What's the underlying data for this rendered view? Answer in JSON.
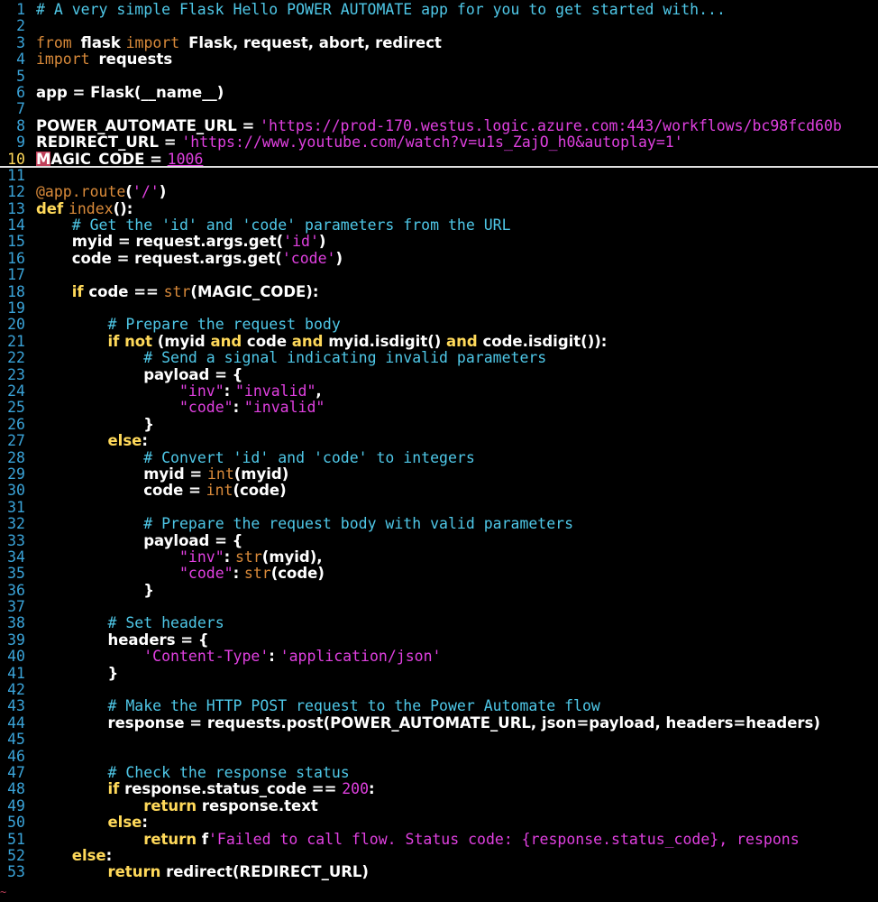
{
  "editor": {
    "lines": [
      {
        "n": "1",
        "tokens": [
          {
            "c": "t-comment",
            "t": "# A very simple Flask Hello POWER AUTOMATE app for you to get started with..."
          }
        ]
      },
      {
        "n": "2",
        "tokens": []
      },
      {
        "n": "3",
        "tokens": [
          {
            "c": "t-kw",
            "t": "from "
          },
          {
            "c": "t-name",
            "t": "flask "
          },
          {
            "c": "t-kw",
            "t": "import "
          },
          {
            "c": "t-name",
            "t": "Flask, request, abort, redirect"
          }
        ]
      },
      {
        "n": "4",
        "tokens": [
          {
            "c": "t-kw",
            "t": "import "
          },
          {
            "c": "t-name",
            "t": "requests"
          }
        ]
      },
      {
        "n": "5",
        "tokens": []
      },
      {
        "n": "6",
        "tokens": [
          {
            "c": "t-name",
            "t": "app = Flask(__name__)"
          }
        ]
      },
      {
        "n": "7",
        "tokens": []
      },
      {
        "n": "8",
        "tokens": [
          {
            "c": "t-name",
            "t": "POWER_AUTOMATE_URL = "
          },
          {
            "c": "t-str",
            "t": "'https://prod-170.westus.logic.azure.com:443/workflows/bc98fcd60b"
          }
        ]
      },
      {
        "n": "9",
        "tokens": [
          {
            "c": "t-name",
            "t": "REDIRECT_URL = "
          },
          {
            "c": "t-str",
            "t": "'https://www.youtube.com/watch?v=u1s_ZajO_h0&autoplay=1'"
          }
        ]
      },
      {
        "n": "10",
        "current": true,
        "tokens": [
          {
            "c": "t-cursor t-name",
            "t": "M"
          },
          {
            "c": "t-name",
            "t": "AGIC_CODE = "
          },
          {
            "c": "t-num t-ul",
            "t": "1006"
          }
        ]
      },
      {
        "n": "11",
        "tokens": []
      },
      {
        "n": "12",
        "tokens": [
          {
            "c": "t-deco",
            "t": "@app.route"
          },
          {
            "c": "t-name",
            "t": "("
          },
          {
            "c": "t-str",
            "t": "'/'"
          },
          {
            "c": "t-name",
            "t": ")"
          }
        ]
      },
      {
        "n": "13",
        "tokens": [
          {
            "c": "t-kwb",
            "t": "def "
          },
          {
            "c": "t-builtin",
            "t": "index"
          },
          {
            "c": "t-name",
            "t": "():"
          }
        ]
      },
      {
        "n": "14",
        "tokens": [
          {
            "c": "t-plain",
            "t": "    "
          },
          {
            "c": "t-comment",
            "t": "# Get the 'id' and 'code' parameters from the URL"
          }
        ]
      },
      {
        "n": "15",
        "tokens": [
          {
            "c": "t-plain",
            "t": "    "
          },
          {
            "c": "t-name",
            "t": "myid = request.args.get("
          },
          {
            "c": "t-str",
            "t": "'id'"
          },
          {
            "c": "t-name",
            "t": ")"
          }
        ]
      },
      {
        "n": "16",
        "tokens": [
          {
            "c": "t-plain",
            "t": "    "
          },
          {
            "c": "t-name",
            "t": "code = request.args.get("
          },
          {
            "c": "t-str",
            "t": "'code'"
          },
          {
            "c": "t-name",
            "t": ")"
          }
        ]
      },
      {
        "n": "17",
        "tokens": []
      },
      {
        "n": "18",
        "tokens": [
          {
            "c": "t-plain",
            "t": "    "
          },
          {
            "c": "t-kwb",
            "t": "if "
          },
          {
            "c": "t-name",
            "t": "code == "
          },
          {
            "c": "t-builtin",
            "t": "str"
          },
          {
            "c": "t-name",
            "t": "(MAGIC_CODE):"
          }
        ]
      },
      {
        "n": "19",
        "tokens": []
      },
      {
        "n": "20",
        "tokens": [
          {
            "c": "t-plain",
            "t": "        "
          },
          {
            "c": "t-comment",
            "t": "# Prepare the request body"
          }
        ]
      },
      {
        "n": "21",
        "tokens": [
          {
            "c": "t-plain",
            "t": "        "
          },
          {
            "c": "t-kwb",
            "t": "if not "
          },
          {
            "c": "t-name",
            "t": "(myid "
          },
          {
            "c": "t-kwb",
            "t": "and "
          },
          {
            "c": "t-name",
            "t": "code "
          },
          {
            "c": "t-kwb",
            "t": "and "
          },
          {
            "c": "t-name",
            "t": "myid.isdigit() "
          },
          {
            "c": "t-kwb",
            "t": "and "
          },
          {
            "c": "t-name",
            "t": "code.isdigit()):"
          }
        ]
      },
      {
        "n": "22",
        "tokens": [
          {
            "c": "t-plain",
            "t": "            "
          },
          {
            "c": "t-comment",
            "t": "# Send a signal indicating invalid parameters"
          }
        ]
      },
      {
        "n": "23",
        "tokens": [
          {
            "c": "t-plain",
            "t": "            "
          },
          {
            "c": "t-name",
            "t": "payload = {"
          }
        ]
      },
      {
        "n": "24",
        "tokens": [
          {
            "c": "t-plain",
            "t": "                "
          },
          {
            "c": "t-str",
            "t": "\"inv\""
          },
          {
            "c": "t-name",
            "t": ": "
          },
          {
            "c": "t-str",
            "t": "\"invalid\""
          },
          {
            "c": "t-name",
            "t": ","
          }
        ]
      },
      {
        "n": "25",
        "tokens": [
          {
            "c": "t-plain",
            "t": "                "
          },
          {
            "c": "t-str",
            "t": "\"code\""
          },
          {
            "c": "t-name",
            "t": ": "
          },
          {
            "c": "t-str",
            "t": "\"invalid\""
          }
        ]
      },
      {
        "n": "26",
        "tokens": [
          {
            "c": "t-plain",
            "t": "            "
          },
          {
            "c": "t-name",
            "t": "}"
          }
        ]
      },
      {
        "n": "27",
        "tokens": [
          {
            "c": "t-plain",
            "t": "        "
          },
          {
            "c": "t-kwb",
            "t": "else"
          },
          {
            "c": "t-name",
            "t": ":"
          }
        ]
      },
      {
        "n": "28",
        "tokens": [
          {
            "c": "t-plain",
            "t": "            "
          },
          {
            "c": "t-comment",
            "t": "# Convert 'id' and 'code' to integers"
          }
        ]
      },
      {
        "n": "29",
        "tokens": [
          {
            "c": "t-plain",
            "t": "            "
          },
          {
            "c": "t-name",
            "t": "myid = "
          },
          {
            "c": "t-builtin",
            "t": "int"
          },
          {
            "c": "t-name",
            "t": "(myid)"
          }
        ]
      },
      {
        "n": "30",
        "tokens": [
          {
            "c": "t-plain",
            "t": "            "
          },
          {
            "c": "t-name",
            "t": "code = "
          },
          {
            "c": "t-builtin",
            "t": "int"
          },
          {
            "c": "t-name",
            "t": "(code)"
          }
        ]
      },
      {
        "n": "31",
        "tokens": []
      },
      {
        "n": "32",
        "tokens": [
          {
            "c": "t-plain",
            "t": "            "
          },
          {
            "c": "t-comment",
            "t": "# Prepare the request body with valid parameters"
          }
        ]
      },
      {
        "n": "33",
        "tokens": [
          {
            "c": "t-plain",
            "t": "            "
          },
          {
            "c": "t-name",
            "t": "payload = {"
          }
        ]
      },
      {
        "n": "34",
        "tokens": [
          {
            "c": "t-plain",
            "t": "                "
          },
          {
            "c": "t-str",
            "t": "\"inv\""
          },
          {
            "c": "t-name",
            "t": ": "
          },
          {
            "c": "t-builtin",
            "t": "str"
          },
          {
            "c": "t-name",
            "t": "(myid),"
          }
        ]
      },
      {
        "n": "35",
        "tokens": [
          {
            "c": "t-plain",
            "t": "                "
          },
          {
            "c": "t-str",
            "t": "\"code\""
          },
          {
            "c": "t-name",
            "t": ": "
          },
          {
            "c": "t-builtin",
            "t": "str"
          },
          {
            "c": "t-name",
            "t": "(code)"
          }
        ]
      },
      {
        "n": "36",
        "tokens": [
          {
            "c": "t-plain",
            "t": "            "
          },
          {
            "c": "t-name",
            "t": "}"
          }
        ]
      },
      {
        "n": "37",
        "tokens": []
      },
      {
        "n": "38",
        "tokens": [
          {
            "c": "t-plain",
            "t": "        "
          },
          {
            "c": "t-comment",
            "t": "# Set headers"
          }
        ]
      },
      {
        "n": "39",
        "tokens": [
          {
            "c": "t-plain",
            "t": "        "
          },
          {
            "c": "t-name",
            "t": "headers = {"
          }
        ]
      },
      {
        "n": "40",
        "tokens": [
          {
            "c": "t-plain",
            "t": "            "
          },
          {
            "c": "t-str",
            "t": "'Content-Type'"
          },
          {
            "c": "t-name",
            "t": ": "
          },
          {
            "c": "t-str",
            "t": "'application/json'"
          }
        ]
      },
      {
        "n": "41",
        "tokens": [
          {
            "c": "t-plain",
            "t": "        "
          },
          {
            "c": "t-name",
            "t": "}"
          }
        ]
      },
      {
        "n": "42",
        "tokens": []
      },
      {
        "n": "43",
        "tokens": [
          {
            "c": "t-plain",
            "t": "        "
          },
          {
            "c": "t-comment",
            "t": "# Make the HTTP POST request to the Power Automate flow"
          }
        ]
      },
      {
        "n": "44",
        "tokens": [
          {
            "c": "t-plain",
            "t": "        "
          },
          {
            "c": "t-name",
            "t": "response = requests.post(POWER_AUTOMATE_URL, json=payload, headers=headers)"
          }
        ]
      },
      {
        "n": "45",
        "tokens": []
      },
      {
        "n": "46",
        "tokens": []
      },
      {
        "n": "47",
        "tokens": [
          {
            "c": "t-plain",
            "t": "        "
          },
          {
            "c": "t-comment",
            "t": "# Check the response status"
          }
        ]
      },
      {
        "n": "48",
        "tokens": [
          {
            "c": "t-plain",
            "t": "        "
          },
          {
            "c": "t-kwb",
            "t": "if "
          },
          {
            "c": "t-name",
            "t": "response.status_code == "
          },
          {
            "c": "t-num",
            "t": "200"
          },
          {
            "c": "t-name",
            "t": ":"
          }
        ]
      },
      {
        "n": "49",
        "tokens": [
          {
            "c": "t-plain",
            "t": "            "
          },
          {
            "c": "t-kwb",
            "t": "return "
          },
          {
            "c": "t-name",
            "t": "response.text"
          }
        ]
      },
      {
        "n": "50",
        "tokens": [
          {
            "c": "t-plain",
            "t": "        "
          },
          {
            "c": "t-kwb",
            "t": "else"
          },
          {
            "c": "t-name",
            "t": ":"
          }
        ]
      },
      {
        "n": "51",
        "tokens": [
          {
            "c": "t-plain",
            "t": "            "
          },
          {
            "c": "t-kwb",
            "t": "return "
          },
          {
            "c": "t-name",
            "t": "f"
          },
          {
            "c": "t-str",
            "t": "'Failed to call flow. Status code: {response.status_code}, respons"
          }
        ]
      },
      {
        "n": "52",
        "tokens": [
          {
            "c": "t-plain",
            "t": "    "
          },
          {
            "c": "t-kwb",
            "t": "else"
          },
          {
            "c": "t-name",
            "t": ":"
          }
        ]
      },
      {
        "n": "53",
        "tokens": [
          {
            "c": "t-plain",
            "t": "        "
          },
          {
            "c": "t-kwb",
            "t": "return "
          },
          {
            "c": "t-name",
            "t": "redirect(REDIRECT_URL)"
          }
        ]
      }
    ],
    "end_of_buffer": "~"
  },
  "colors": {
    "background": "#000000",
    "line_number": "#3aa3d8",
    "current_line_number": "#ffd95a",
    "comment": "#4fc8e8",
    "keyword": "#ffd95a",
    "import_keyword": "#d98a3a",
    "string": "#e040e0",
    "cursor": "#c0405a"
  }
}
